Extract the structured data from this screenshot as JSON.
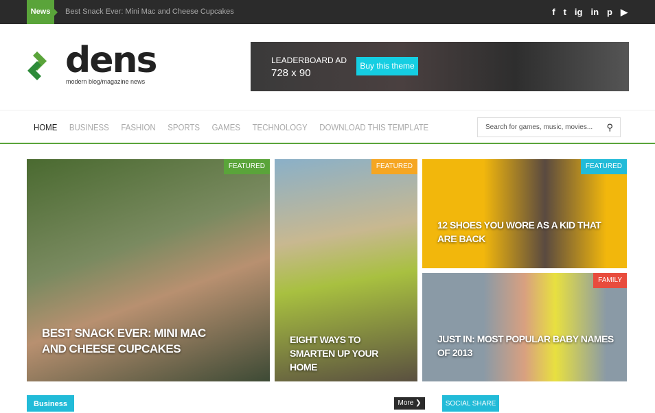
{
  "topbar": {
    "badge": "News",
    "ticker": "Best Snack Ever: Mini Mac and Cheese Cupcakes",
    "social": [
      "f",
      "t",
      "ig",
      "in",
      "p",
      "▶"
    ]
  },
  "logo": {
    "word": "dens",
    "tagline": "modern blog/magazine news"
  },
  "ad": {
    "line1": "LEADERBOARD AD",
    "line2": "728 x 90",
    "button": "Buy this theme"
  },
  "nav": {
    "items": [
      "HOME",
      "BUSINESS",
      "FASHION",
      "SPORTS",
      "GAMES",
      "TECHNOLOGY",
      "DOWNLOAD THIS TEMPLATE"
    ],
    "search_placeholder": "Search for games, music, movies..."
  },
  "cards": [
    {
      "badge": "FEATURED",
      "badge_color": "#5aa43a",
      "title": "BEST SNACK EVER: MINI MAC AND CHEESE CUPCAKES"
    },
    {
      "badge": "FEATURED",
      "badge_color": "#f5a623",
      "title": "EIGHT WAYS TO SMARTEN UP YOUR HOME"
    },
    {
      "badge": "FEATURED",
      "badge_color": "#22bbd8",
      "title": "12 SHOES YOU WORE AS A KID THAT ARE BACK"
    },
    {
      "badge": "FAMILY",
      "badge_color": "#e84c3d",
      "title": "JUST IN: MOST POPULAR BABY NAMES OF 2013"
    }
  ],
  "sections": {
    "business": "Business",
    "more": "More ❯",
    "social": "SOCIAL SHARE"
  }
}
